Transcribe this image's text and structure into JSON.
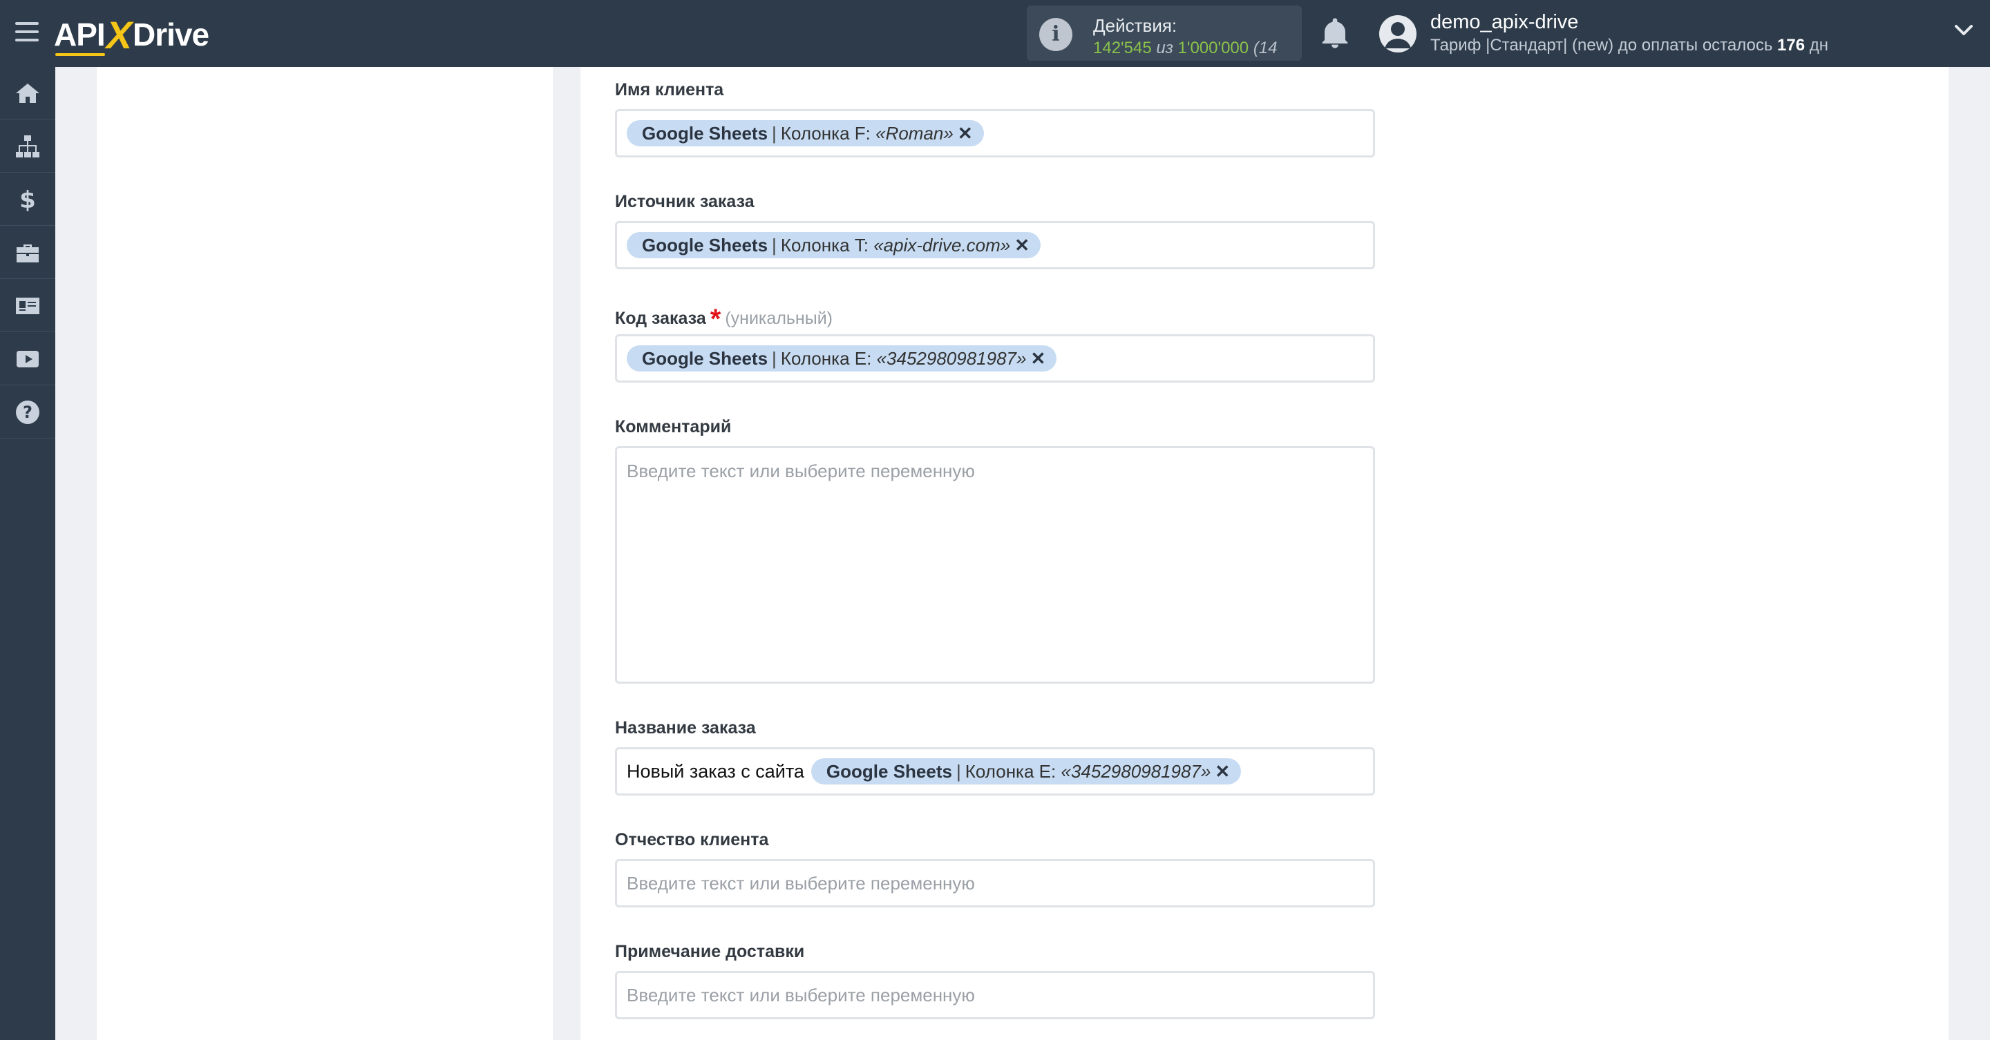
{
  "header": {
    "logo_left": "API",
    "logo_x": "X",
    "logo_right": "Drive",
    "actions": {
      "title": "Действия:",
      "used": "142'545",
      "of": "из",
      "limit": "1'000'000",
      "extra": "(14"
    },
    "user": {
      "name": "demo_apix-drive",
      "plan_prefix": "Тариф |Стандарт| (new) до оплаты осталось ",
      "days": "176",
      "days_suffix": " дн"
    }
  },
  "sidebar": {
    "items": [
      {
        "icon": "home-icon"
      },
      {
        "icon": "sitemap-icon"
      },
      {
        "icon": "dollar-icon"
      },
      {
        "icon": "briefcase-icon"
      },
      {
        "icon": "id-card-icon"
      },
      {
        "icon": "youtube-icon"
      },
      {
        "icon": "help-icon"
      }
    ]
  },
  "form": {
    "client_name": {
      "label": "Имя клиента",
      "tag": {
        "source": "Google Sheets",
        "sep": "|",
        "column": "Колонка F:",
        "value": "«Roman»"
      }
    },
    "order_source": {
      "label": "Источник заказа",
      "tag": {
        "source": "Google Sheets",
        "sep": "|",
        "column": "Колонка T:",
        "value": "«apix-drive.com»"
      }
    },
    "order_code": {
      "label": "Код заказа",
      "required": "*",
      "hint": "(уникальный)",
      "tag": {
        "source": "Google Sheets",
        "sep": "|",
        "column": "Колонка E:",
        "value": "«3452980981987»"
      }
    },
    "comment": {
      "label": "Комментарий",
      "placeholder": "Введите текст или выберите переменную"
    },
    "order_name": {
      "label": "Название заказа",
      "text": "Новый заказ с сайта",
      "tag": {
        "source": "Google Sheets",
        "sep": "|",
        "column": "Колонка E:",
        "value": "«3452980981987»"
      }
    },
    "patronymic": {
      "label": "Отчество клиента",
      "placeholder": "Введите текст или выберите переменную"
    },
    "delivery_note": {
      "label": "Примечание доставки",
      "placeholder": "Введите текст или выберите переменную"
    }
  },
  "colors": {
    "topbar": "#2d3b4a",
    "accent": "#f5c518",
    "tag_bg": "#c7dcf3",
    "actions_green": "#8bc34a",
    "required": "#e0131a"
  }
}
